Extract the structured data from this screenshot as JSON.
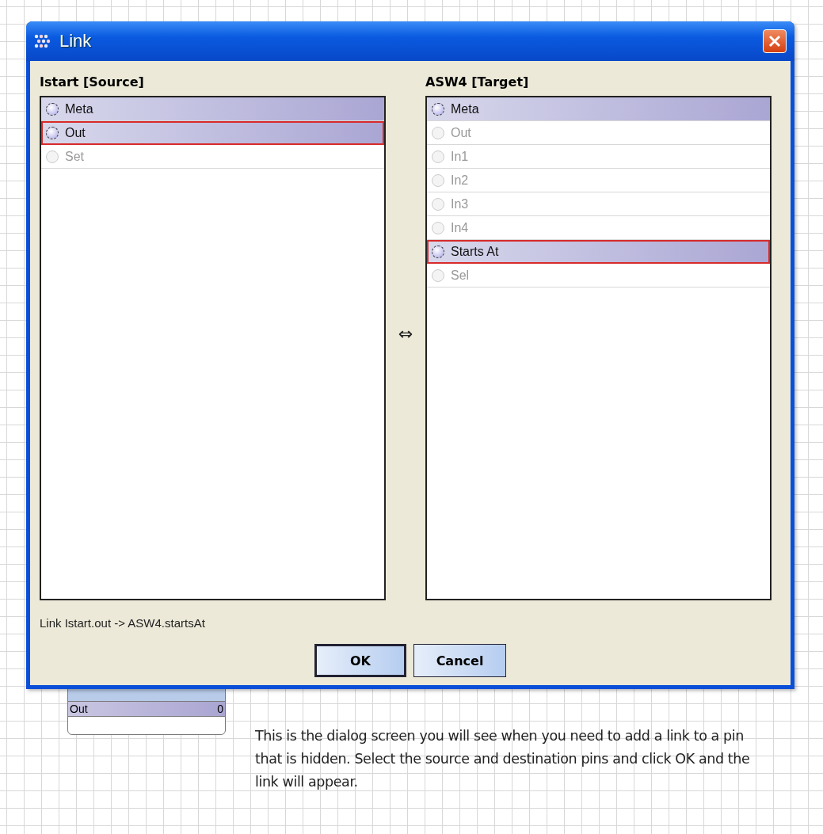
{
  "window": {
    "title": "Link"
  },
  "source": {
    "heading": "Istart [Source]",
    "rows": [
      {
        "label": "Meta",
        "enabled": true,
        "selected": false
      },
      {
        "label": "Out",
        "enabled": true,
        "selected": true
      },
      {
        "label": "Set",
        "enabled": false,
        "selected": false
      }
    ]
  },
  "swap_symbol": "⇔",
  "target": {
    "heading": "ASW4 [Target]",
    "rows": [
      {
        "label": "Meta",
        "enabled": true,
        "selected": false
      },
      {
        "label": "Out",
        "enabled": false,
        "selected": false
      },
      {
        "label": "In1",
        "enabled": false,
        "selected": false
      },
      {
        "label": "In2",
        "enabled": false,
        "selected": false
      },
      {
        "label": "In3",
        "enabled": false,
        "selected": false
      },
      {
        "label": "In4",
        "enabled": false,
        "selected": false
      },
      {
        "label": "Starts At",
        "enabled": true,
        "selected": true
      },
      {
        "label": "Sel",
        "enabled": false,
        "selected": false
      }
    ]
  },
  "status": "Link Istart.out -> ASW4.startsAt",
  "buttons": [
    {
      "label": "OK",
      "default": true
    },
    {
      "label": "Cancel",
      "default": false
    }
  ],
  "background_node": {
    "slot": "Out",
    "value": "0"
  },
  "note": "This is the dialog screen you will see when you need to add a link to a pin that is hidden.  Select the source and destination pins and click OK and the link will appear."
}
